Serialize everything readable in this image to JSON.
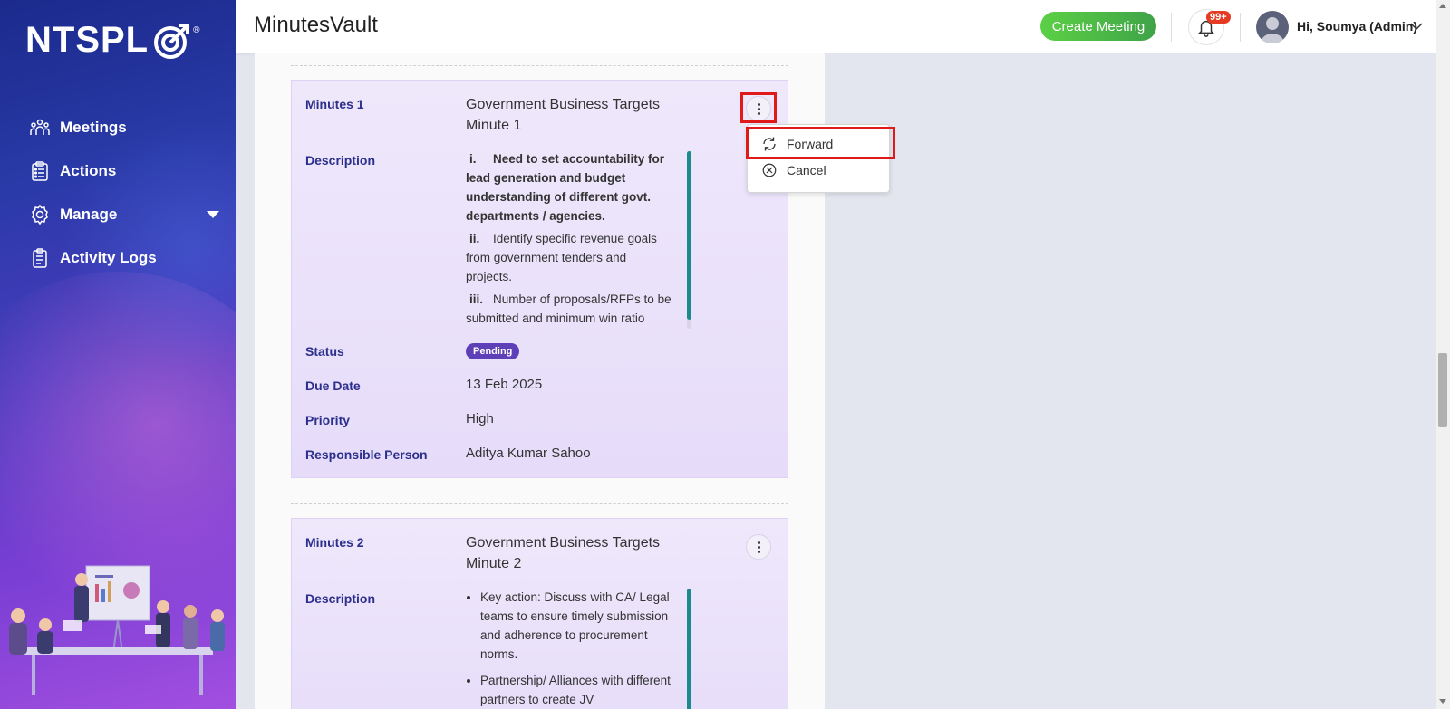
{
  "sidebar": {
    "logo_text": "NTSPL",
    "logo_registered": "®",
    "items": [
      {
        "label": "Meetings",
        "icon": "meetings-icon"
      },
      {
        "label": "Actions",
        "icon": "clipboard-list-icon"
      },
      {
        "label": "Manage",
        "icon": "gear-icon"
      },
      {
        "label": "Activity Logs",
        "icon": "activity-log-icon"
      }
    ]
  },
  "header": {
    "title": "MinutesVault",
    "create_button": "Create Meeting",
    "notification_badge": "99+",
    "user_greeting": "Hi, Soumya (Admin)"
  },
  "minutes": [
    {
      "label": "Minutes 1",
      "title": "Government Business Targets Minute 1",
      "description_label": "Description",
      "description_items": [
        {
          "num": "i.",
          "text": "Need to set accountability for lead generation and budget understanding of different govt. departments / agencies.",
          "bold": true
        },
        {
          "num": "ii.",
          "text": "Identify specific revenue goals from government tenders and projects.",
          "bold": false
        },
        {
          "num": "iii.",
          "text": "Number of proposals/RFPs to be submitted and minimum win ratio targets",
          "bold": false
        }
      ],
      "status_label": "Status",
      "status": "Pending",
      "due_date_label": "Due Date",
      "due_date": "13 Feb 2025",
      "priority_label": "Priority",
      "priority": "High",
      "responsible_label": "Responsible Person",
      "responsible": "Aditya Kumar Sahoo"
    },
    {
      "label": "Minutes 2",
      "title": "Government Business Targets Minute 2",
      "description_label": "Description",
      "description_bullets": [
        "Key action: Discuss with CA/ Legal teams to ensure timely submission and adherence to procurement norms.",
        "Partnership/ Alliances with different partners to create JV"
      ]
    }
  ],
  "context_menu": {
    "forward": "Forward",
    "cancel": "Cancel"
  },
  "colors": {
    "label_blue": "#2c2f8c",
    "status_pending": "#5f3fb7",
    "create_button_green": "#4cbb47",
    "highlight_red": "#e01919",
    "scroll_teal": "#1a8a8a"
  }
}
